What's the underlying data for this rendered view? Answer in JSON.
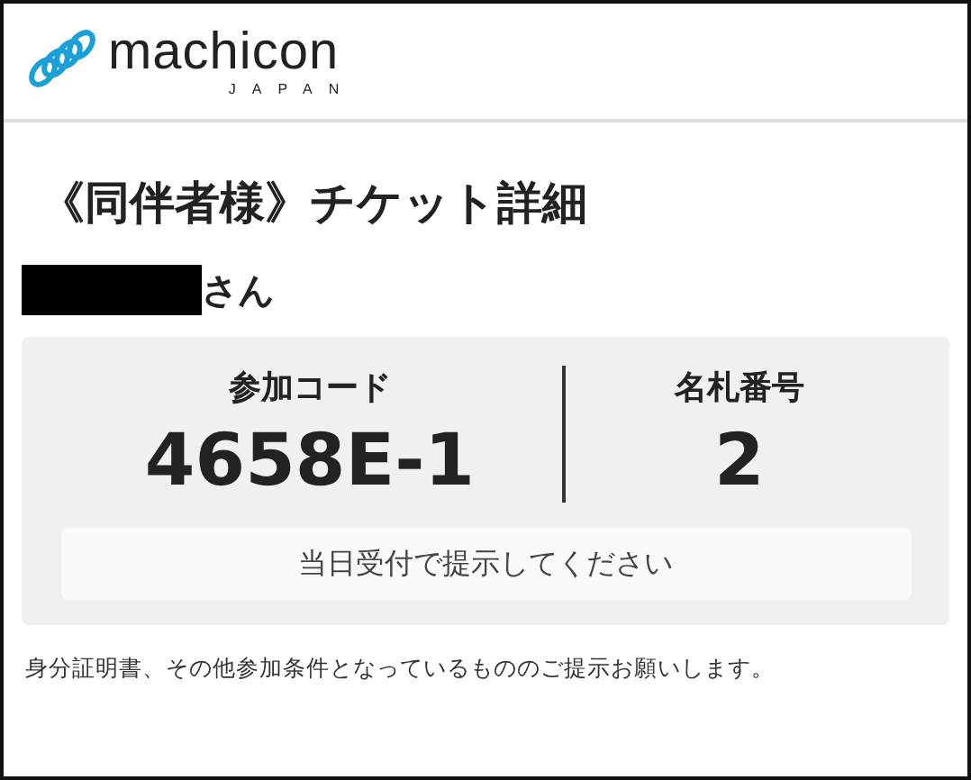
{
  "logo": {
    "name": "machicon",
    "sub": "JAPAN"
  },
  "title": "《同伴者様》チケット詳細",
  "guest": {
    "redacted": true,
    "suffix": "さん"
  },
  "ticket": {
    "fields": [
      {
        "label": "参加コード",
        "value": "4658E-1"
      },
      {
        "label": "名札番号",
        "value": "2"
      }
    ],
    "notice": "当日受付で提示してください"
  },
  "footnote": "身分証明書、その他参加条件となっているもののご提示お願いします。"
}
